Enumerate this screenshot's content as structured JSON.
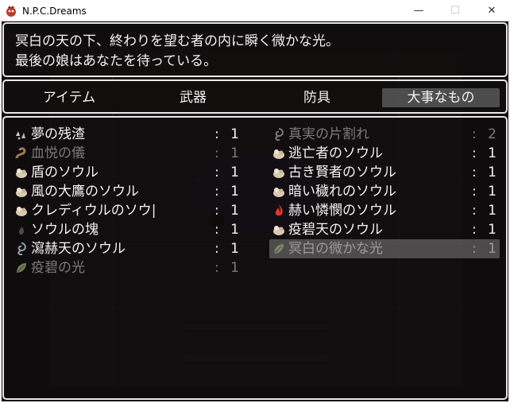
{
  "window": {
    "title": "N.P.C.Dreams",
    "minimize_glyph": "—",
    "maximize_glyph": "☐",
    "close_glyph": "✕"
  },
  "help": {
    "line1": "冥白の天の下、終わりを望む者の内に瞬く微かな光。",
    "line2": "最後の娘はあなたを待っている。"
  },
  "categories": [
    {
      "label": "アイテム"
    },
    {
      "label": "武器"
    },
    {
      "label": "防具"
    },
    {
      "label": "大事なもの"
    }
  ],
  "items": [
    {
      "name": "夢の残渣",
      "colon": ":",
      "qty": "1",
      "icon": "residue-icon"
    },
    {
      "name": "真実の片割れ",
      "colon": ":",
      "qty": "2",
      "icon": "swirl-icon"
    },
    {
      "name": "血悦の儀",
      "colon": ":",
      "qty": "1",
      "icon": "serpent-icon"
    },
    {
      "name": "逃亡者のソウル",
      "colon": ":",
      "qty": "1",
      "icon": "soul-icon"
    },
    {
      "name": "盾のソウル",
      "colon": ":",
      "qty": "1",
      "icon": "soul-icon"
    },
    {
      "name": "古き賢者のソウル",
      "colon": ":",
      "qty": "1",
      "icon": "soul-icon"
    },
    {
      "name": "風の大鷹のソウル",
      "colon": ":",
      "qty": "1",
      "icon": "soul-icon"
    },
    {
      "name": "暗い穢れのソウル",
      "colon": ":",
      "qty": "1",
      "icon": "soul-icon"
    },
    {
      "name": "クレディウルのソウ|",
      "colon": ":",
      "qty": "1",
      "icon": "soul-icon"
    },
    {
      "name": "赫い憐憫のソウル",
      "colon": ":",
      "qty": "1",
      "icon": "flame-icon"
    },
    {
      "name": "ソウルの塊",
      "colon": ":",
      "qty": "1",
      "icon": "soul-mass-icon"
    },
    {
      "name": "疫碧天のソウル",
      "colon": ":",
      "qty": "1",
      "icon": "soul-icon"
    },
    {
      "name": "瀉赫天のソウル",
      "colon": ":",
      "qty": "1",
      "icon": "swirl-icon"
    },
    {
      "name": "冥白の微かな光",
      "colon": ":",
      "qty": "1",
      "icon": "leaf-icon"
    },
    {
      "name": "疫碧の光",
      "colon": ":",
      "qty": "1",
      "icon": "leaf-icon"
    }
  ],
  "colors": {
    "text": "#f2f2f2",
    "text_disabled": "#7a7a7a",
    "panel_border": "#e8e8e8",
    "background": "#0e0b0b",
    "soul_icon": "#d9c9b0",
    "flame_icon": "#e0382a",
    "leaf_icon": "#8c9a6a"
  }
}
